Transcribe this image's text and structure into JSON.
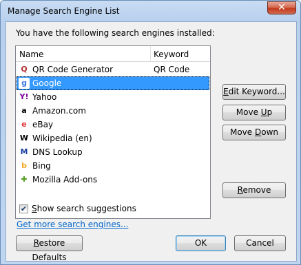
{
  "window": {
    "title": "Manage Search Engine List",
    "close_glyph": "✕"
  },
  "intro_text": "You have the following search engines installed:",
  "list": {
    "columns": {
      "name": "Name",
      "keyword": "Keyword"
    },
    "rows": [
      {
        "name": "QR Code Generator",
        "keyword": "QR Code",
        "icon": "qr-code-icon",
        "glyph": "Q",
        "color": "#b03030",
        "selected": false
      },
      {
        "name": "Google",
        "keyword": "",
        "icon": "google-icon",
        "glyph": "g",
        "color": "#3b78e7",
        "selected": true
      },
      {
        "name": "Yahoo",
        "keyword": "",
        "icon": "yahoo-icon",
        "glyph": "Y!",
        "color": "#7b0099",
        "selected": false
      },
      {
        "name": "Amazon.com",
        "keyword": "",
        "icon": "amazon-icon",
        "glyph": "a",
        "color": "#000000",
        "selected": false
      },
      {
        "name": "eBay",
        "keyword": "",
        "icon": "ebay-icon",
        "glyph": "e",
        "color": "#e53238",
        "selected": false
      },
      {
        "name": "Wikipedia (en)",
        "keyword": "",
        "icon": "wikipedia-icon",
        "glyph": "W",
        "color": "#000000",
        "selected": false
      },
      {
        "name": "DNS Lookup",
        "keyword": "",
        "icon": "dns-lookup-icon",
        "glyph": "M",
        "color": "#1a3fa0",
        "selected": false
      },
      {
        "name": "Bing",
        "keyword": "",
        "icon": "bing-icon",
        "glyph": "b",
        "color": "#f5a623",
        "selected": false
      },
      {
        "name": "Mozilla Add-ons",
        "keyword": "",
        "icon": "puzzle-piece-icon",
        "glyph": "✚",
        "color": "#5aa02c",
        "selected": false
      }
    ]
  },
  "buttons": {
    "edit_keyword": {
      "pre": "",
      "accel": "E",
      "post": "dit Keyword..."
    },
    "move_up": {
      "pre": "Move ",
      "accel": "U",
      "post": "p"
    },
    "move_down": {
      "pre": "Move ",
      "accel": "D",
      "post": "own"
    },
    "remove": {
      "pre": "",
      "accel": "R",
      "post": "emove"
    },
    "restore_defaults": {
      "pre": "",
      "accel": "R",
      "post": "estore Defaults"
    },
    "ok": "OK",
    "cancel": "Cancel"
  },
  "suggestions": {
    "checked": true,
    "check_glyph": "✔",
    "label_accel": "S",
    "label_rest": "how search suggestions"
  },
  "get_more_link": "Get more search engines...",
  "colors": {
    "selection": "#3399ff",
    "link": "#0066cc"
  }
}
